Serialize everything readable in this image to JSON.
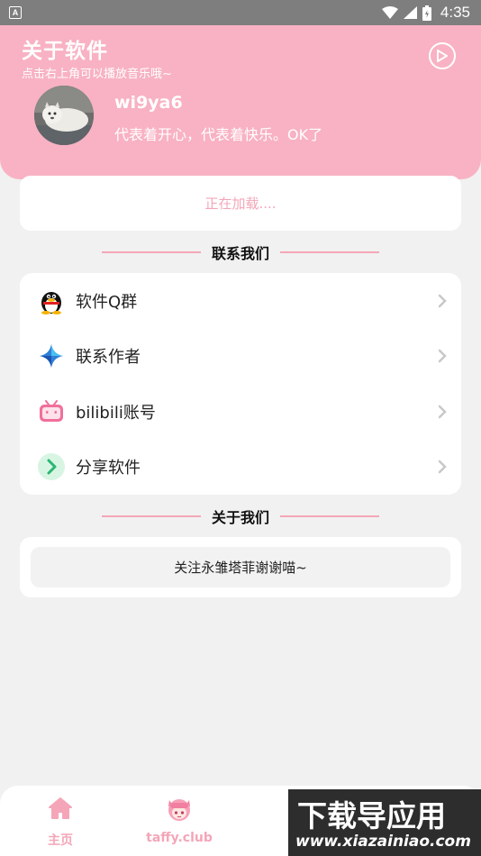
{
  "status_bar": {
    "app_icon_letter": "A",
    "time": "4:35"
  },
  "header": {
    "title": "关于软件",
    "subtitle": "点击右上角可以播放音乐哦~",
    "username": "wi9ya6",
    "bio": "代表着开心，代表着快乐。OK了"
  },
  "loading": {
    "text": "正在加载...."
  },
  "contact_section": {
    "title": "联系我们",
    "items": [
      {
        "label": "软件Q群",
        "icon": "qq-penguin-icon"
      },
      {
        "label": "联系作者",
        "icon": "star-sparkle-icon"
      },
      {
        "label": "bilibili账号",
        "icon": "bilibili-tv-icon"
      },
      {
        "label": "分享软件",
        "icon": "share-arrow-icon"
      }
    ]
  },
  "about_section": {
    "title": "关于我们",
    "text": "关注永雏塔菲谢谢喵~"
  },
  "bottom_nav": {
    "items": [
      {
        "label": "主页",
        "icon": "home-icon"
      },
      {
        "label": "taffy.club",
        "icon": "taffy-avatar-icon"
      }
    ]
  },
  "watermark": {
    "main": "下载导应用",
    "sub": "www.xiazainiao.com"
  },
  "colors": {
    "accent_pink": "#f8b2c3",
    "text_pink": "#f4a6b8",
    "background": "#f1f1f1"
  }
}
